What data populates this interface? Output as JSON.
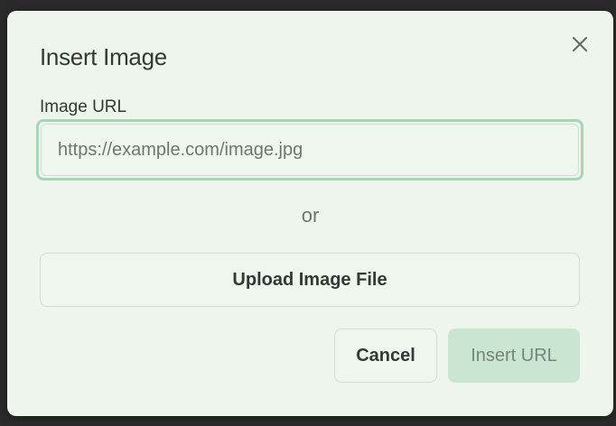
{
  "dialog": {
    "title": "Insert Image",
    "close_icon": "close-icon",
    "url_label": "Image URL",
    "url_value": "",
    "url_placeholder": "https://example.com/image.jpg",
    "separator": "or",
    "upload_label": "Upload Image File",
    "cancel_label": "Cancel",
    "insert_label": "Insert URL",
    "insert_disabled": true
  },
  "colors": {
    "dialog_bg": "#edf5ed",
    "focus_ring": "#a8d5b4",
    "primary_disabled_bg": "#c9e6d1",
    "primary_disabled_text": "#76857b",
    "text": "#2f3b34",
    "muted_text": "#6c7770"
  }
}
